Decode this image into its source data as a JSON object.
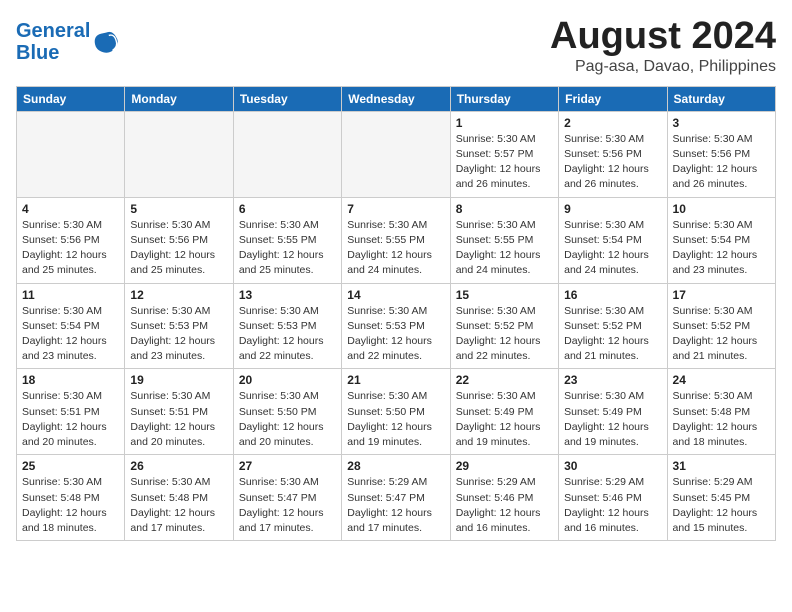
{
  "header": {
    "logo_line1": "General",
    "logo_line2": "Blue",
    "month": "August 2024",
    "location": "Pag-asa, Davao, Philippines"
  },
  "weekdays": [
    "Sunday",
    "Monday",
    "Tuesday",
    "Wednesday",
    "Thursday",
    "Friday",
    "Saturday"
  ],
  "weeks": [
    [
      {
        "day": "",
        "info": ""
      },
      {
        "day": "",
        "info": ""
      },
      {
        "day": "",
        "info": ""
      },
      {
        "day": "",
        "info": ""
      },
      {
        "day": "1",
        "info": "Sunrise: 5:30 AM\nSunset: 5:57 PM\nDaylight: 12 hours\nand 26 minutes."
      },
      {
        "day": "2",
        "info": "Sunrise: 5:30 AM\nSunset: 5:56 PM\nDaylight: 12 hours\nand 26 minutes."
      },
      {
        "day": "3",
        "info": "Sunrise: 5:30 AM\nSunset: 5:56 PM\nDaylight: 12 hours\nand 26 minutes."
      }
    ],
    [
      {
        "day": "4",
        "info": "Sunrise: 5:30 AM\nSunset: 5:56 PM\nDaylight: 12 hours\nand 25 minutes."
      },
      {
        "day": "5",
        "info": "Sunrise: 5:30 AM\nSunset: 5:56 PM\nDaylight: 12 hours\nand 25 minutes."
      },
      {
        "day": "6",
        "info": "Sunrise: 5:30 AM\nSunset: 5:55 PM\nDaylight: 12 hours\nand 25 minutes."
      },
      {
        "day": "7",
        "info": "Sunrise: 5:30 AM\nSunset: 5:55 PM\nDaylight: 12 hours\nand 24 minutes."
      },
      {
        "day": "8",
        "info": "Sunrise: 5:30 AM\nSunset: 5:55 PM\nDaylight: 12 hours\nand 24 minutes."
      },
      {
        "day": "9",
        "info": "Sunrise: 5:30 AM\nSunset: 5:54 PM\nDaylight: 12 hours\nand 24 minutes."
      },
      {
        "day": "10",
        "info": "Sunrise: 5:30 AM\nSunset: 5:54 PM\nDaylight: 12 hours\nand 23 minutes."
      }
    ],
    [
      {
        "day": "11",
        "info": "Sunrise: 5:30 AM\nSunset: 5:54 PM\nDaylight: 12 hours\nand 23 minutes."
      },
      {
        "day": "12",
        "info": "Sunrise: 5:30 AM\nSunset: 5:53 PM\nDaylight: 12 hours\nand 23 minutes."
      },
      {
        "day": "13",
        "info": "Sunrise: 5:30 AM\nSunset: 5:53 PM\nDaylight: 12 hours\nand 22 minutes."
      },
      {
        "day": "14",
        "info": "Sunrise: 5:30 AM\nSunset: 5:53 PM\nDaylight: 12 hours\nand 22 minutes."
      },
      {
        "day": "15",
        "info": "Sunrise: 5:30 AM\nSunset: 5:52 PM\nDaylight: 12 hours\nand 22 minutes."
      },
      {
        "day": "16",
        "info": "Sunrise: 5:30 AM\nSunset: 5:52 PM\nDaylight: 12 hours\nand 21 minutes."
      },
      {
        "day": "17",
        "info": "Sunrise: 5:30 AM\nSunset: 5:52 PM\nDaylight: 12 hours\nand 21 minutes."
      }
    ],
    [
      {
        "day": "18",
        "info": "Sunrise: 5:30 AM\nSunset: 5:51 PM\nDaylight: 12 hours\nand 20 minutes."
      },
      {
        "day": "19",
        "info": "Sunrise: 5:30 AM\nSunset: 5:51 PM\nDaylight: 12 hours\nand 20 minutes."
      },
      {
        "day": "20",
        "info": "Sunrise: 5:30 AM\nSunset: 5:50 PM\nDaylight: 12 hours\nand 20 minutes."
      },
      {
        "day": "21",
        "info": "Sunrise: 5:30 AM\nSunset: 5:50 PM\nDaylight: 12 hours\nand 19 minutes."
      },
      {
        "day": "22",
        "info": "Sunrise: 5:30 AM\nSunset: 5:49 PM\nDaylight: 12 hours\nand 19 minutes."
      },
      {
        "day": "23",
        "info": "Sunrise: 5:30 AM\nSunset: 5:49 PM\nDaylight: 12 hours\nand 19 minutes."
      },
      {
        "day": "24",
        "info": "Sunrise: 5:30 AM\nSunset: 5:48 PM\nDaylight: 12 hours\nand 18 minutes."
      }
    ],
    [
      {
        "day": "25",
        "info": "Sunrise: 5:30 AM\nSunset: 5:48 PM\nDaylight: 12 hours\nand 18 minutes."
      },
      {
        "day": "26",
        "info": "Sunrise: 5:30 AM\nSunset: 5:48 PM\nDaylight: 12 hours\nand 17 minutes."
      },
      {
        "day": "27",
        "info": "Sunrise: 5:30 AM\nSunset: 5:47 PM\nDaylight: 12 hours\nand 17 minutes."
      },
      {
        "day": "28",
        "info": "Sunrise: 5:29 AM\nSunset: 5:47 PM\nDaylight: 12 hours\nand 17 minutes."
      },
      {
        "day": "29",
        "info": "Sunrise: 5:29 AM\nSunset: 5:46 PM\nDaylight: 12 hours\nand 16 minutes."
      },
      {
        "day": "30",
        "info": "Sunrise: 5:29 AM\nSunset: 5:46 PM\nDaylight: 12 hours\nand 16 minutes."
      },
      {
        "day": "31",
        "info": "Sunrise: 5:29 AM\nSunset: 5:45 PM\nDaylight: 12 hours\nand 15 minutes."
      }
    ]
  ]
}
